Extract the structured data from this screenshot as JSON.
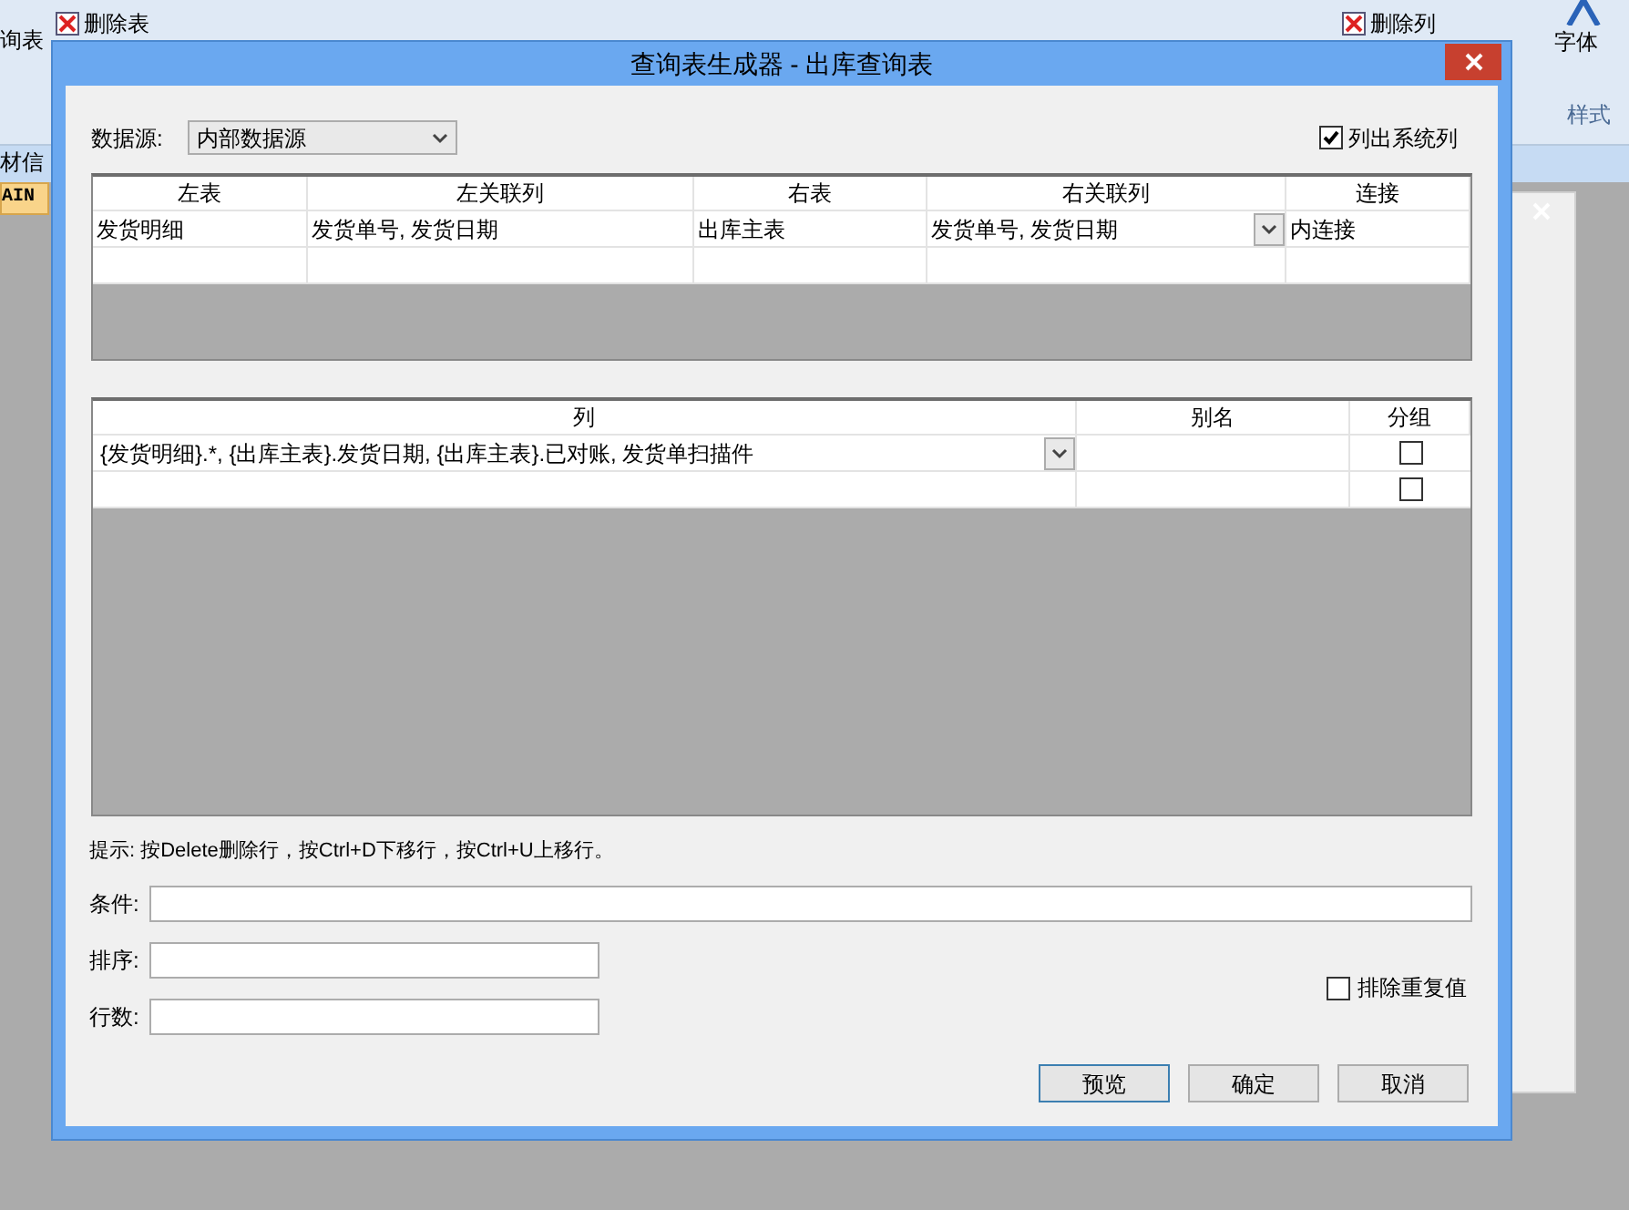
{
  "ribbon": {
    "left_label": "询表",
    "buttons": [
      {
        "label": "删除表"
      },
      {
        "label": "删除列"
      }
    ],
    "right_label": "字体",
    "group_label": "样式"
  },
  "background": {
    "sidebar_text": "材信",
    "tab_label": "AIN"
  },
  "dialog": {
    "title": "查询表生成器 - 出库查询表",
    "datasource": {
      "label": "数据源:",
      "value": "内部数据源"
    },
    "show_system_columns": {
      "label": "列出系统列",
      "checked": true
    },
    "join_grid": {
      "columns": [
        "左表",
        "左关联列",
        "右表",
        "右关联列",
        "连接"
      ],
      "rows": [
        {
          "cells": [
            "发货明细",
            "发货单号, 发货日期",
            "出库主表",
            "发货单号, 发货日期",
            "内连接"
          ],
          "has_dropdown": true
        },
        {
          "cells": [
            "",
            "",
            "",
            "",
            ""
          ],
          "has_dropdown": false
        }
      ]
    },
    "column_grid": {
      "columns": [
        "列",
        "别名",
        "分组"
      ],
      "rows": [
        {
          "column": "{发货明细}.*, {出库主表}.发货日期, {出库主表}.已对账, 发货单扫描件",
          "has_dropdown": true,
          "alias": "",
          "group": false
        },
        {
          "column": "",
          "has_dropdown": false,
          "alias": "",
          "group": false
        }
      ]
    },
    "hint": "提示: 按Delete删除行，按Ctrl+D下移行，按Ctrl+U上移行。",
    "fields": [
      {
        "label": "条件:",
        "wide": true
      },
      {
        "label": "排序:",
        "wide": false
      },
      {
        "label": "行数:",
        "wide": false
      }
    ],
    "distinct": {
      "label": "排除重复值",
      "checked": false
    },
    "buttons": [
      {
        "label": "预览",
        "default": true
      },
      {
        "label": "确定",
        "default": false
      },
      {
        "label": "取消",
        "default": false
      }
    ]
  }
}
